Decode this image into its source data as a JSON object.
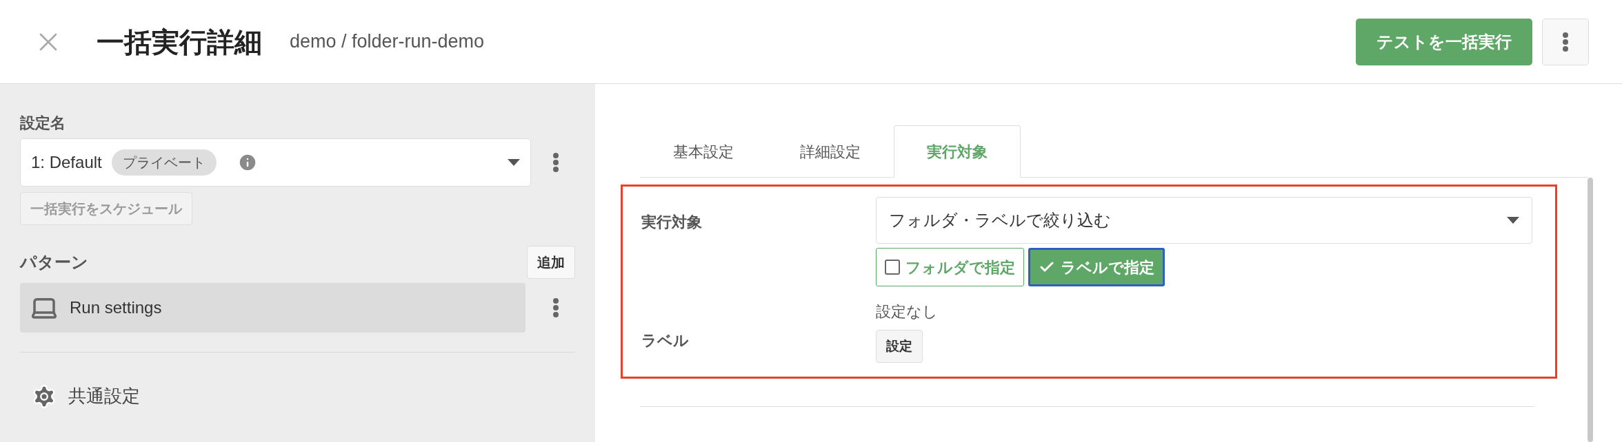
{
  "header": {
    "title": "一括実行詳細",
    "subtitle": "demo / folder-run-demo",
    "run_button": "テストを一括実行"
  },
  "sidebar": {
    "config_label": "設定名",
    "config_select": {
      "value": "1: Default",
      "badge": "プライベート"
    },
    "schedule_button": {
      "label": "一括実行をスケジュール",
      "disabled": true
    },
    "pattern_label": "パターン",
    "add_button": "追加",
    "patterns": [
      {
        "label": "Run settings",
        "selected": true
      }
    ],
    "common_settings": "共通設定"
  },
  "tabs": [
    {
      "label": "基本設定",
      "selected": false
    },
    {
      "label": "詳細設定",
      "selected": false
    },
    {
      "label": "実行対象",
      "selected": true
    }
  ],
  "target": {
    "label": "実行対象",
    "select_value": "フォルダ・ラベルで絞り込む",
    "options": [
      {
        "label": "フォルダで指定",
        "checked": false
      },
      {
        "label": "ラベルで指定",
        "checked": true
      }
    ]
  },
  "label_field": {
    "label": "ラベル",
    "value": "設定なし",
    "button": "設定"
  }
}
